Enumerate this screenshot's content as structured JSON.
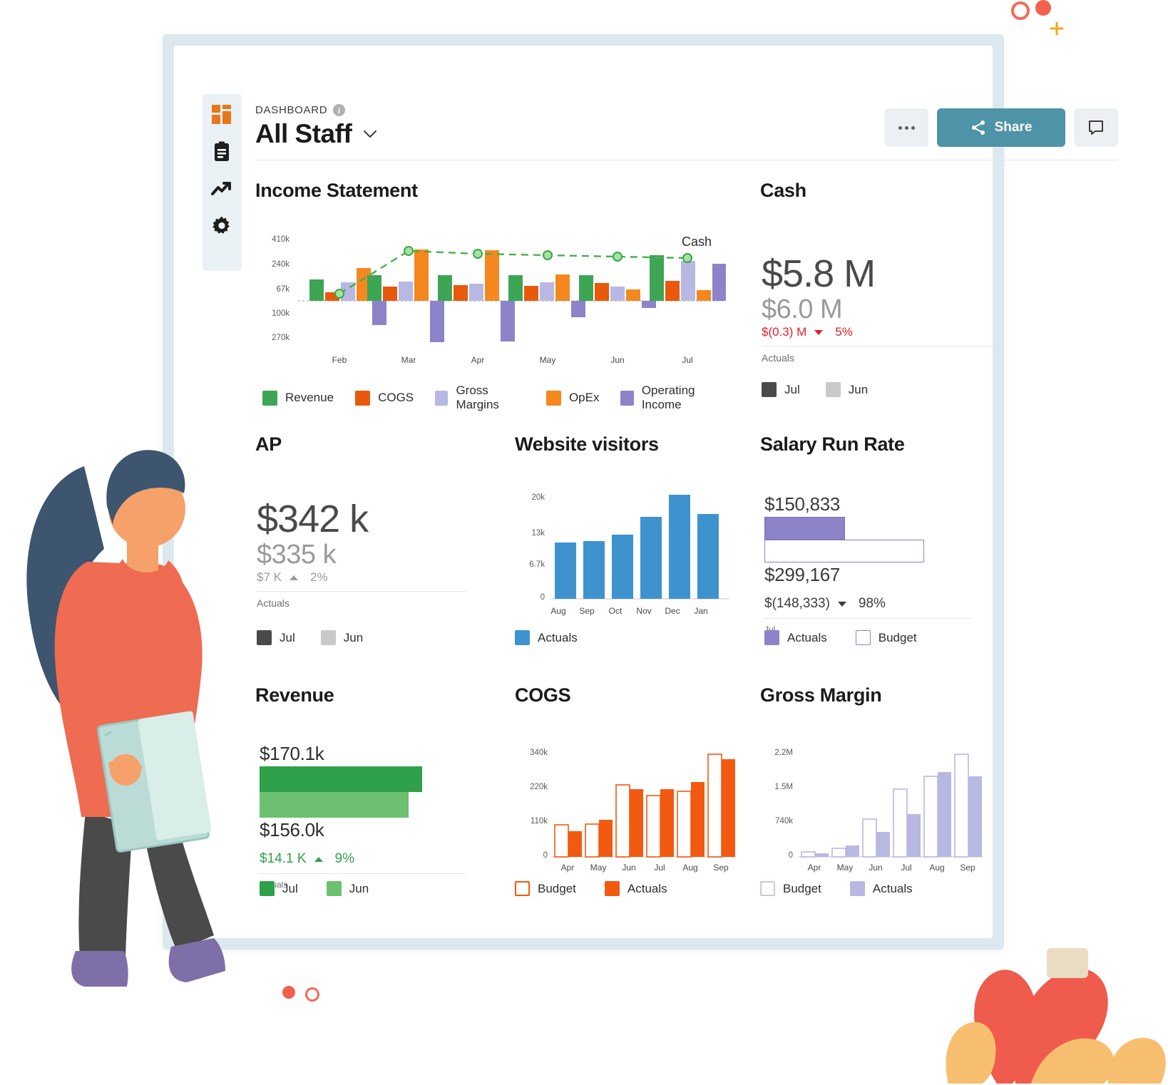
{
  "header": {
    "breadcrumb": "DASHBOARD",
    "info_icon": "info-icon",
    "title": "All Staff",
    "more_label": "...",
    "share_label": "Share",
    "comment_icon": "comment-icon",
    "chevron_icon": "chevron-down-icon"
  },
  "sidebar": {
    "items": [
      {
        "icon": "grid-dashboard-icon",
        "label": "Dashboard"
      },
      {
        "icon": "clipboard-icon",
        "label": "Reports"
      },
      {
        "icon": "trending-up-icon",
        "label": "Analytics"
      },
      {
        "icon": "gear-icon",
        "label": "Settings"
      }
    ]
  },
  "colors": {
    "revenue": "#3DA554",
    "cogs": "#E8590C",
    "gross_margins": "#B9B8E2",
    "opex": "#F5871F",
    "operating_income": "#8C83C8",
    "cash_line": "#45B04B",
    "visitors_blue": "#3E93CE",
    "jul_dark": "#4A4A4A",
    "jun_grey": "#C9C9C9",
    "revenue_jul": "#2FA14A",
    "revenue_jun": "#6CC070",
    "salary_actuals": "#8C83C8",
    "salary_budget": "#FFFFFF",
    "negative_red": "#E0202B",
    "positive_green": "#2FA14A",
    "neutral_grey": "#9A9A9A",
    "share_button": "#4F93A8"
  },
  "panels": {
    "income_statement": {
      "title": "Income Statement",
      "legend": [
        {
          "label": "Revenue",
          "color": "#3DA554"
        },
        {
          "label": "COGS",
          "color": "#E8590C"
        },
        {
          "label": "Gross Margins",
          "color": "#B9B8E2"
        },
        {
          "label": "OpEx",
          "color": "#F5871F"
        },
        {
          "label": "Operating Income",
          "color": "#8C83C8"
        }
      ]
    },
    "cash": {
      "title": "Cash",
      "primary": "$5.8 M",
      "secondary": "$6.0 M",
      "delta_value": "$(0.3) M",
      "delta_pct": "5%",
      "delta_direction": "down",
      "footnote": "Actuals",
      "legend": [
        {
          "label": "Jul",
          "color": "#4A4A4A"
        },
        {
          "label": "Jun",
          "color": "#C9C9C9"
        }
      ]
    },
    "ap": {
      "title": "AP",
      "primary": "$342 k",
      "secondary": "$335 k",
      "delta_value": "$7 K",
      "delta_pct": "2%",
      "delta_direction": "up",
      "footnote": "Actuals",
      "legend": [
        {
          "label": "Jul",
          "color": "#4A4A4A"
        },
        {
          "label": "Jun",
          "color": "#C9C9C9"
        }
      ]
    },
    "website_visitors": {
      "title": "Website visitors",
      "legend": [
        {
          "label": "Actuals",
          "color": "#3E93CE"
        }
      ]
    },
    "salary_run_rate": {
      "title": "Salary Run Rate",
      "actuals_label": "$150,833",
      "budget_label": "$299,167",
      "delta_value": "$(148,333)",
      "delta_pct": "98%",
      "delta_direction": "down",
      "footnote": "Jul",
      "legend": [
        {
          "label": "Actuals",
          "color": "#8C83C8"
        },
        {
          "label": "Budget",
          "color": "#FFFFFF"
        }
      ]
    },
    "revenue": {
      "title": "Revenue",
      "actuals_label": "$170.1k",
      "budget_label": "$156.0k",
      "delta_value": "$14.1 K",
      "delta_pct": "9%",
      "delta_direction": "up",
      "footnote": "Actuals",
      "legend": [
        {
          "label": "Jul",
          "color": "#2FA14A"
        },
        {
          "label": "Jun",
          "color": "#6CC070"
        }
      ]
    },
    "cogs": {
      "title": "COGS",
      "legend": [
        {
          "label": "Budget",
          "color": "#FFFFFF"
        },
        {
          "label": "Actuals",
          "color": "#F15A10"
        }
      ]
    },
    "gross_margin": {
      "title": "Gross Margin",
      "legend": [
        {
          "label": "Budget",
          "color": "#FFFFFF"
        },
        {
          "label": "Actuals",
          "color": "#B9B8E2"
        }
      ]
    }
  },
  "chart_data": [
    {
      "id": "income_statement",
      "type": "bar",
      "title": "Income Statement",
      "xlabel": "",
      "ylabel": "",
      "categories": [
        "Feb",
        "Mar",
        "Apr",
        "May",
        "Jun",
        "Jul"
      ],
      "yticks": [
        "410k",
        "240k",
        "67k",
        "100k",
        "270k"
      ],
      "ytick_values": [
        410000,
        240000,
        67000,
        -100000,
        -270000
      ],
      "ylim": [
        -340000,
        450000
      ],
      "grid": false,
      "legend_position": "bottom",
      "series": [
        {
          "name": "Revenue",
          "color": "#3DA554",
          "values": [
            75000,
            105000,
            105000,
            105000,
            105000,
            240000
          ]
        },
        {
          "name": "COGS",
          "color": "#E8590C",
          "values": [
            30000,
            52000,
            60000,
            58000,
            68000,
            78000
          ]
        },
        {
          "name": "Gross Margins",
          "color": "#B9B8E2",
          "values": [
            64000,
            67000,
            62000,
            67000,
            55000,
            215000
          ]
        },
        {
          "name": "OpEx",
          "color": "#F5871F",
          "values": [
            210000,
            290000,
            285000,
            105000,
            44000,
            42000
          ]
        },
        {
          "name": "Operating Income",
          "color": "#8C83C8",
          "values": [
            -118000,
            -215000,
            -210000,
            -72000,
            -28000,
            198000
          ]
        }
      ],
      "overlay_line": {
        "name": "Cash",
        "color": "#45B04B",
        "style": "dashed",
        "marker": "circle",
        "annotation": "Cash",
        "values": [
          40000,
          320000,
          305000,
          300000,
          298000,
          290000
        ]
      }
    },
    {
      "id": "website_visitors",
      "type": "bar",
      "title": "Website visitors",
      "categories": [
        "Aug",
        "Sep",
        "Oct",
        "Nov",
        "Dec",
        "Jan"
      ],
      "yticks": [
        "20k",
        "13k",
        "6.7k",
        "0"
      ],
      "ytick_values": [
        20000,
        13000,
        6700,
        0
      ],
      "ylim": [
        0,
        21500
      ],
      "grid": false,
      "legend_position": "bottom",
      "series": [
        {
          "name": "Actuals",
          "color": "#3E93CE",
          "values": [
            10500,
            10700,
            11900,
            15100,
            19500,
            15700
          ]
        }
      ]
    },
    {
      "id": "cogs",
      "type": "bar",
      "title": "COGS",
      "categories": [
        "Apr",
        "May",
        "Jun",
        "Jul",
        "Aug",
        "Sep"
      ],
      "yticks": [
        "340k",
        "220k",
        "110k",
        "0"
      ],
      "ytick_values": [
        340000,
        220000,
        110000,
        0
      ],
      "ylim": [
        0,
        360000
      ],
      "grid": false,
      "legend_position": "bottom",
      "series": [
        {
          "name": "Budget",
          "color": "#FFFFFF",
          "values": [
            105000,
            106000,
            235000,
            200000,
            215000,
            335000
          ]
        },
        {
          "name": "Actuals",
          "color": "#F15A10",
          "values": [
            85000,
            122000,
            222000,
            222000,
            245000,
            318000
          ]
        }
      ]
    },
    {
      "id": "gross_margin",
      "type": "bar",
      "title": "Gross Margin",
      "categories": [
        "Apr",
        "May",
        "Jun",
        "Jul",
        "Aug",
        "Sep"
      ],
      "yticks": [
        "2.2M",
        "1.5M",
        "740k",
        "0"
      ],
      "ytick_values": [
        2200000,
        1500000,
        740000,
        0
      ],
      "ylim": [
        0,
        2350000
      ],
      "grid": false,
      "legend_position": "bottom",
      "series": [
        {
          "name": "Budget",
          "color": "#FFFFFF",
          "values": [
            105000,
            185000,
            800000,
            1430000,
            1700000,
            2200000
          ]
        },
        {
          "name": "Actuals",
          "color": "#B9B8E2",
          "values": [
            70000,
            250000,
            530000,
            900000,
            1790000,
            1700000
          ]
        }
      ]
    },
    {
      "id": "salary_run_rate",
      "type": "bar",
      "orientation": "horizontal",
      "title": "Salary Run Rate",
      "series": [
        {
          "name": "Actuals",
          "color": "#8C83C8",
          "values": [
            150833
          ]
        },
        {
          "name": "Budget",
          "color": "#FFFFFF",
          "values": [
            299167
          ]
        }
      ],
      "xlim": [
        0,
        299167
      ]
    },
    {
      "id": "revenue",
      "type": "bar",
      "orientation": "horizontal",
      "title": "Revenue",
      "series": [
        {
          "name": "Jul",
          "color": "#2FA14A",
          "values": [
            170100
          ]
        },
        {
          "name": "Jun",
          "color": "#6CC070",
          "values": [
            156000
          ]
        }
      ],
      "xlim": [
        0,
        170100
      ]
    }
  ]
}
